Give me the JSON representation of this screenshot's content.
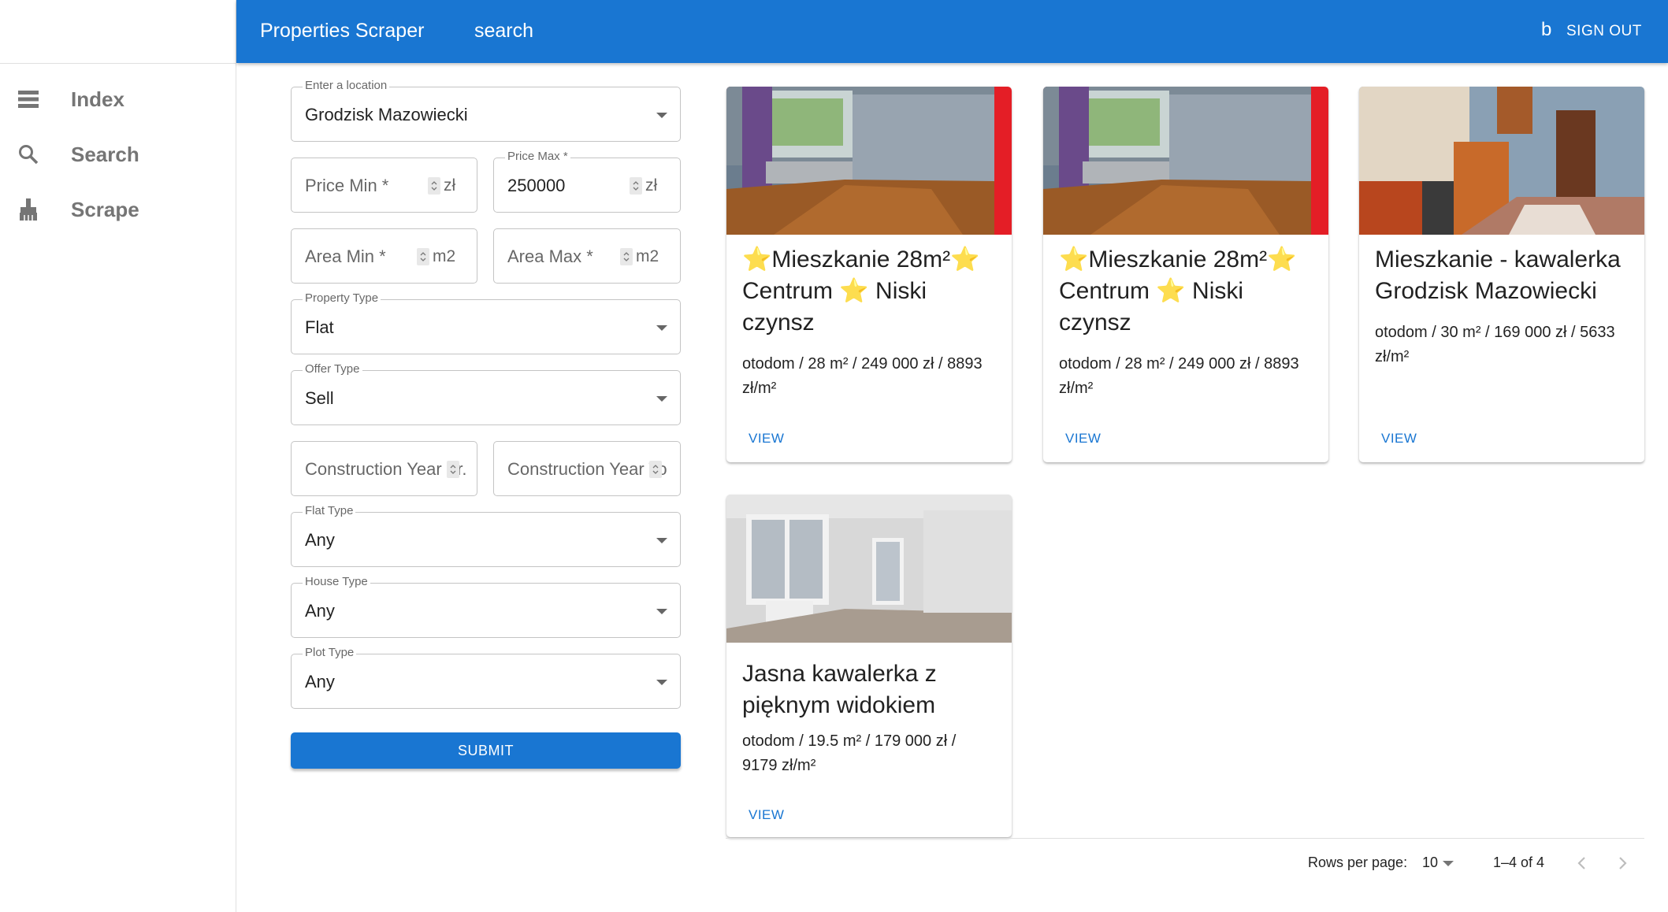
{
  "sidebar": {
    "items": [
      {
        "label": "Index",
        "icon": "list-icon"
      },
      {
        "label": "Search",
        "icon": "search-icon"
      },
      {
        "label": "Scrape",
        "icon": "cleaning-brush-icon"
      }
    ]
  },
  "header": {
    "title": "Properties Scraper",
    "search_link": "search",
    "user_initial": "b",
    "signout": "SIGN OUT",
    "color": "#1976d2"
  },
  "form": {
    "location": {
      "label": "Enter a location",
      "value": "Grodzisk Mazowiecki"
    },
    "price_min": {
      "placeholder": "Price Min *",
      "unit": "zł"
    },
    "price_max": {
      "label": "Price Max *",
      "value": "250000",
      "unit": "zł"
    },
    "area_min": {
      "placeholder": "Area Min *",
      "unit": "m2"
    },
    "area_max": {
      "placeholder": "Area Max *",
      "unit": "m2"
    },
    "property_type": {
      "label": "Property Type",
      "value": "Flat"
    },
    "offer_type": {
      "label": "Offer Type",
      "value": "Sell"
    },
    "construction_year_from": {
      "placeholder": "Construction Year Fr..."
    },
    "construction_year_to": {
      "placeholder": "Construction Year To *"
    },
    "flat_type": {
      "label": "Flat Type",
      "value": "Any"
    },
    "house_type": {
      "label": "House Type",
      "value": "Any"
    },
    "plot_type": {
      "label": "Plot Type",
      "value": "Any"
    },
    "submit": "SUBMIT"
  },
  "results": [
    {
      "title": "⭐Mieszkanie 28m²⭐ Centrum ⭐ Niski czynsz",
      "desc": "otodom / 28 m² / 249 000 zł / 8893 zł/m²",
      "action": "VIEW",
      "image": "room-photo-red-border-icon"
    },
    {
      "title": "⭐Mieszkanie 28m²⭐ Centrum ⭐ Niski czynsz",
      "desc": "otodom / 28 m² / 249 000 zł / 8893 zł/m²",
      "action": "VIEW",
      "image": "room-photo-red-border-icon"
    },
    {
      "title": "Mieszkanie - kawalerka Grodzisk Mazowiecki",
      "desc": "otodom / 30 m² / 169 000 zł / 5633 zł/m²",
      "action": "VIEW",
      "image": "kitchen-photo-icon"
    },
    {
      "title": "Jasna kawalerka z pięknym widokiem",
      "desc": "otodom / 19.5 m² / 179 000 zł / 9179 zł/m²",
      "action": "VIEW",
      "image": "bright-room-photo-icon"
    }
  ],
  "pagination": {
    "rows_label": "Rows per page:",
    "rows_value": "10",
    "range": "1–4 of 4"
  }
}
